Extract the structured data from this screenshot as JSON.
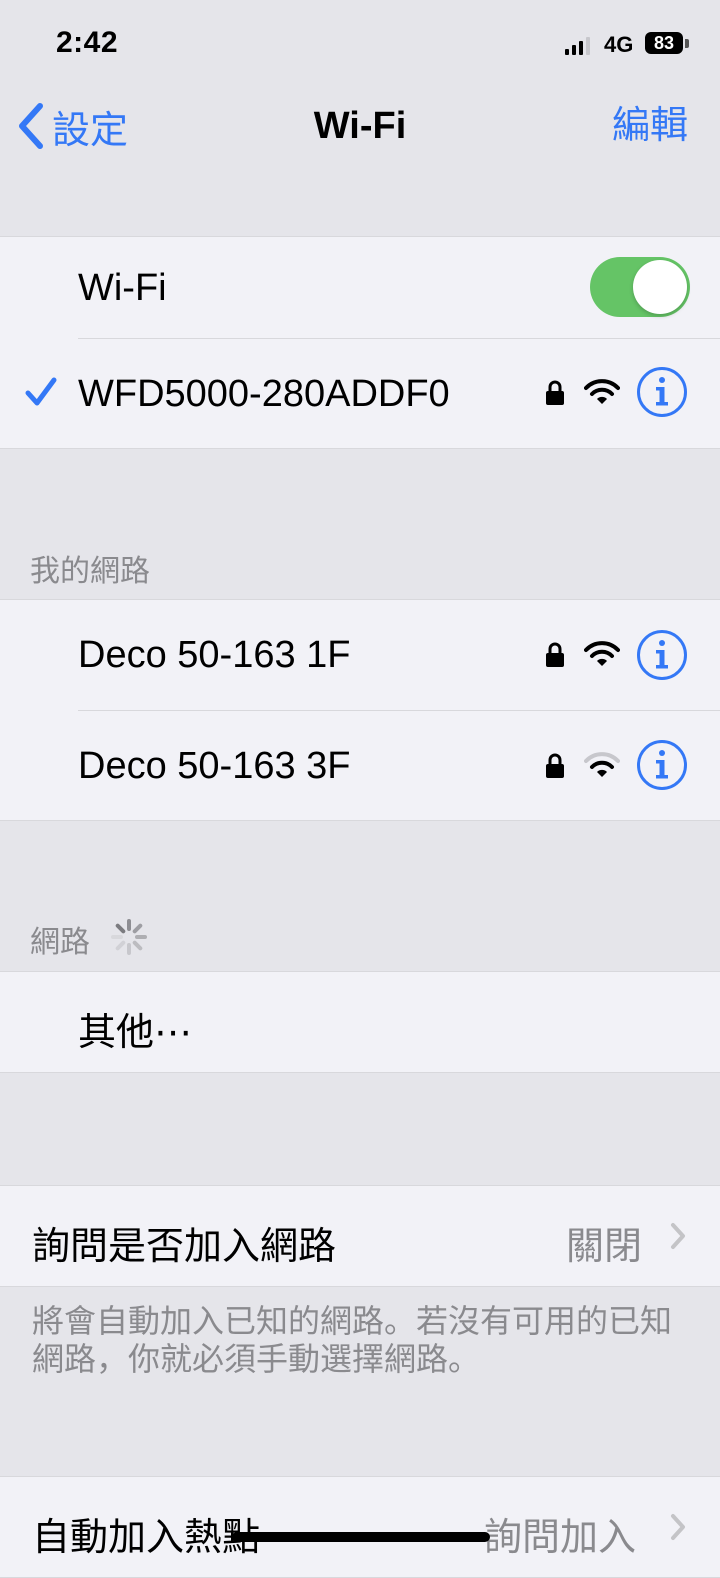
{
  "status": {
    "time": "2:42",
    "network": "4G",
    "battery": "83"
  },
  "nav": {
    "back_label": "設定",
    "title": "Wi-Fi",
    "edit_label": "編輯"
  },
  "wifi_toggle": {
    "label": "Wi-Fi",
    "on": true
  },
  "connected": {
    "name": "WFD5000-280ADDF0",
    "secured": true,
    "signal": "full"
  },
  "my_networks": {
    "header": "我的網路",
    "items": [
      {
        "name": "Deco 50-163 1F",
        "secured": true,
        "signal": "full"
      },
      {
        "name": "Deco 50-163 3F",
        "secured": true,
        "signal": "partial"
      }
    ]
  },
  "networks": {
    "header": "網路",
    "other_label": "其他⋯"
  },
  "ask_join": {
    "label": "詢問是否加入網路",
    "value": "關閉"
  },
  "ask_join_note": "將會自動加入已知的網路。若沒有可用的已知網路，你就必須手動選擇網路。",
  "auto_hotspot": {
    "label": "自動加入熱點",
    "value": "詢問加入"
  },
  "colors": {
    "accent": "#3478f6",
    "toggle_on": "#65c466",
    "background": "#e5e5ea",
    "cell": "#f2f2f7"
  }
}
